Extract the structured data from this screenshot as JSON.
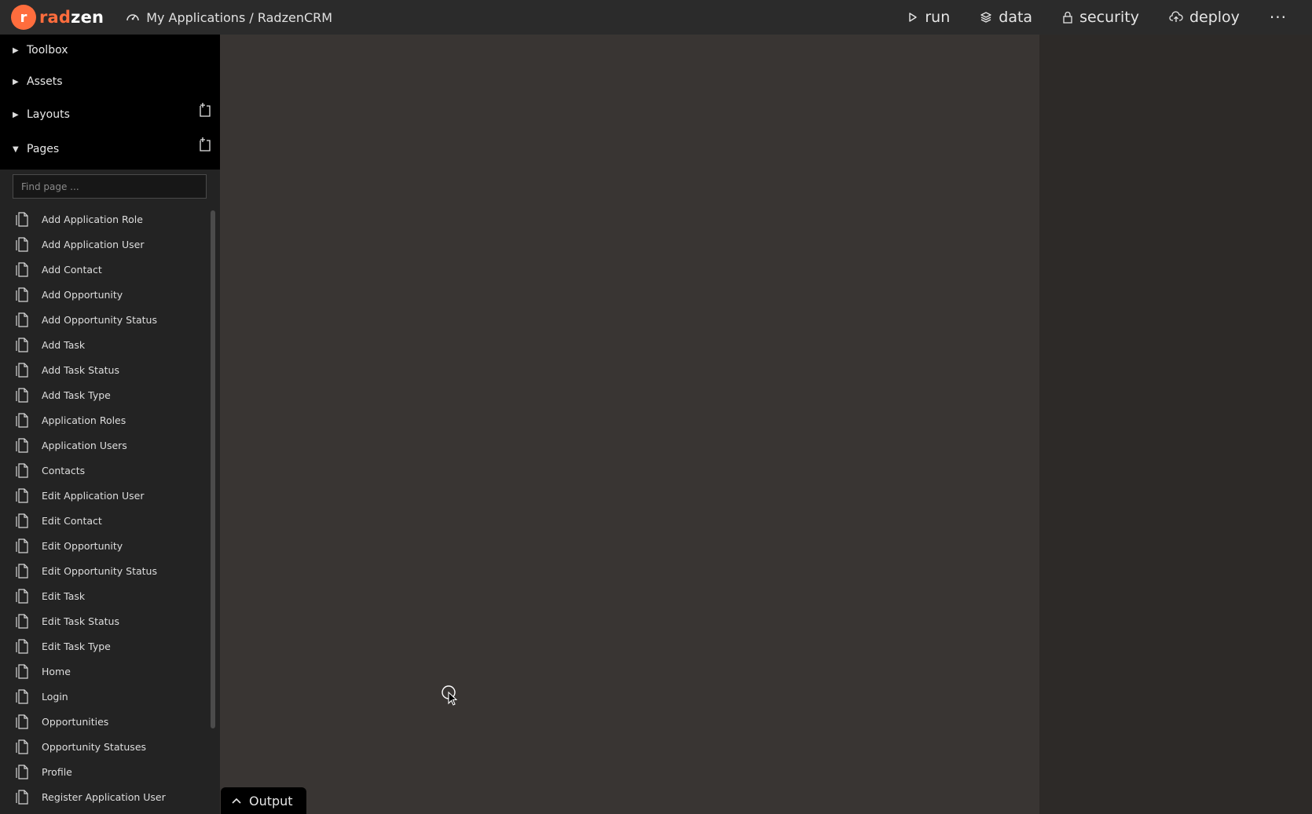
{
  "header": {
    "logo_text_r": "rad",
    "logo_text_z": "zen",
    "breadcrumb": "My Applications / RadzenCRM",
    "nav": [
      {
        "label": "run",
        "icon": "play-icon"
      },
      {
        "label": "data",
        "icon": "layers-icon"
      },
      {
        "label": "security",
        "icon": "lock-icon"
      },
      {
        "label": "deploy",
        "icon": "cloud-upload-icon"
      }
    ],
    "more": "···"
  },
  "sidebar": {
    "sections": [
      {
        "label": "Toolbox",
        "expanded": false
      },
      {
        "label": "Assets",
        "expanded": false
      },
      {
        "label": "Layouts",
        "expanded": false
      },
      {
        "label": "Pages",
        "expanded": true
      }
    ],
    "search_placeholder": "Find page ...",
    "pages": [
      "Add Application Role",
      "Add Application User",
      "Add Contact",
      "Add Opportunity",
      "Add Opportunity Status",
      "Add Task",
      "Add Task Status",
      "Add Task Type",
      "Application Roles",
      "Application Users",
      "Contacts",
      "Edit Application User",
      "Edit Contact",
      "Edit Opportunity",
      "Edit Opportunity Status",
      "Edit Task",
      "Edit Task Status",
      "Edit Task Type",
      "Home",
      "Login",
      "Opportunities",
      "Opportunity Statuses",
      "Profile",
      "Register Application User"
    ]
  },
  "output": {
    "label": "Output"
  },
  "colors": {
    "brand": "#ff6d3d",
    "sidebar": "#000000",
    "canvas": "#393533",
    "topbar": "#2b2b2b"
  }
}
